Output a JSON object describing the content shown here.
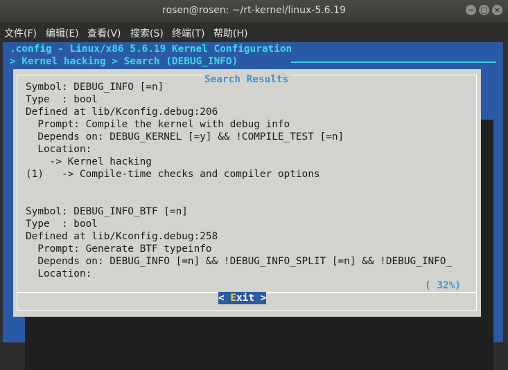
{
  "window": {
    "title": "rosen@rosen: ~/rt-kernel/linux-5.6.19"
  },
  "menubar": [
    "文件(F)",
    "编辑(E)",
    "查看(V)",
    "搜索(S)",
    "终端(T)",
    "帮助(H)"
  ],
  "terminal": {
    "config_title": ".config - Linux/x86 5.6.19 Kernel Configuration",
    "breadcrumb": "> Kernel hacking > Search (DEBUG_INFO)"
  },
  "dialog": {
    "title": "Search Results",
    "lines": [
      "Symbol: DEBUG_INFO [=n]",
      "Type  : bool",
      "Defined at lib/Kconfig.debug:206",
      "  Prompt: Compile the kernel with debug info",
      "  Depends on: DEBUG_KERNEL [=y] && !COMPILE_TEST [=n]",
      "  Location:",
      "    -> Kernel hacking",
      "(1)   -> Compile-time checks and compiler options",
      "",
      "",
      "Symbol: DEBUG_INFO_BTF [=n]",
      "Type  : bool",
      "Defined at lib/Kconfig.debug:258",
      "  Prompt: Generate BTF typeinfo",
      "  Depends on: DEBUG_INFO [=n] && !DEBUG_INFO_SPLIT [=n] && !DEBUG_INFO_",
      "  Location:"
    ],
    "scroll_percent": "( 32%)",
    "exit_button": {
      "left": "< ",
      "hotkey": "E",
      "rest": "xit >"
    }
  },
  "colors": {
    "terminal_blue": "#2a5aa5",
    "accent_cyan": "#3fd7e8",
    "dialog_bg": "#d3d3ce",
    "hotkey_yellow": "#e9d62c"
  }
}
